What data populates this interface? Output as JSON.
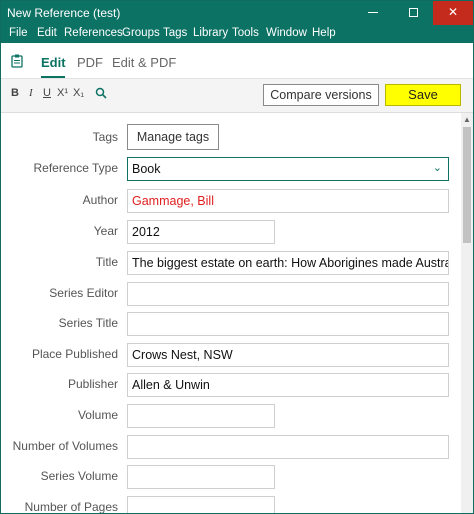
{
  "window": {
    "title": "New Reference (test)",
    "controls": {
      "close": "✕"
    }
  },
  "menu": [
    "File",
    "Edit",
    "References",
    "Groups",
    "Tags",
    "Library",
    "Tools",
    "Window",
    "Help"
  ],
  "tabs": {
    "edit": "Edit",
    "pdf": "PDF",
    "edit_pdf": "Edit & PDF",
    "active": "Edit"
  },
  "toolbar": {
    "bold": "B",
    "italic": "I",
    "underline": "U",
    "superscript": "X¹",
    "subscript": "X₁",
    "compare_label": "Compare versions",
    "save_label": "Save",
    "save_color": "#ffff00"
  },
  "form": {
    "tags_label": "Tags",
    "manage_tags": "Manage tags",
    "fields": [
      {
        "label": "Reference Type",
        "value": "Book"
      },
      {
        "label": "Author",
        "value": "Gammage, Bill"
      },
      {
        "label": "Year",
        "value": "2012"
      },
      {
        "label": "Title",
        "value": "The biggest estate on earth: How Aborigines made Australia"
      },
      {
        "label": "Series Editor",
        "value": ""
      },
      {
        "label": "Series Title",
        "value": ""
      },
      {
        "label": "Place Published",
        "value": "Crows Nest, NSW"
      },
      {
        "label": "Publisher",
        "value": "Allen & Unwin"
      },
      {
        "label": "Volume",
        "value": ""
      },
      {
        "label": "Number of Volumes",
        "value": ""
      },
      {
        "label": "Series Volume",
        "value": ""
      },
      {
        "label": "Number of Pages",
        "value": ""
      }
    ]
  },
  "colors": {
    "accent": "#0c7264",
    "author_text": "#e02020",
    "close_button": "#c42b1c"
  }
}
